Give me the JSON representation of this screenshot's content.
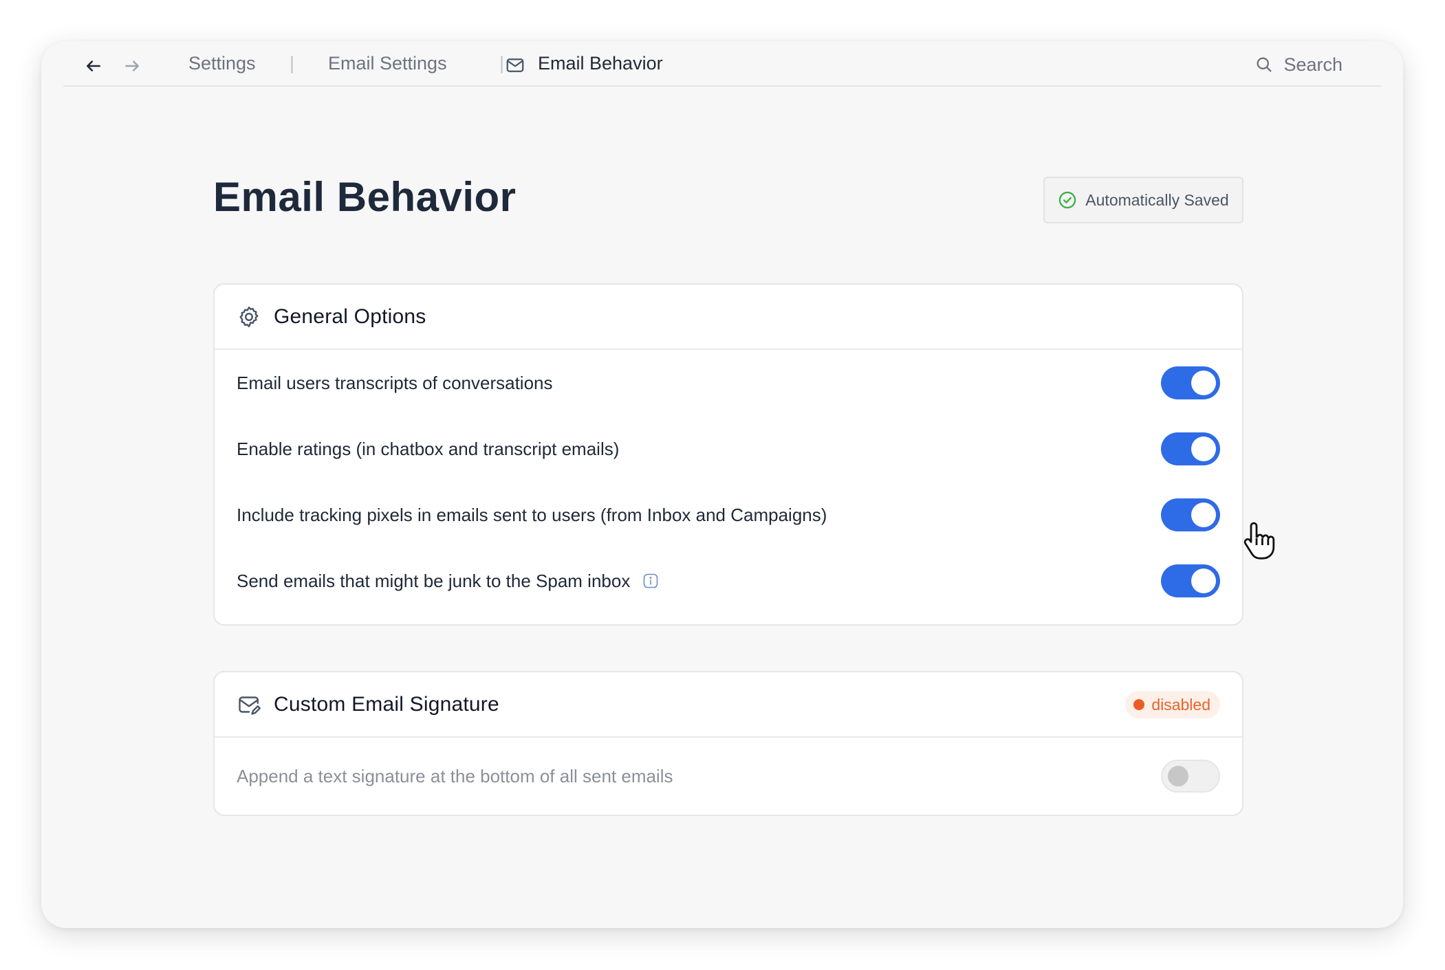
{
  "breadcrumb": {
    "items": [
      "Settings",
      "Email Settings"
    ],
    "separator": "|",
    "current": "Email Behavior"
  },
  "search": {
    "placeholder": "Search"
  },
  "page": {
    "title": "Email Behavior"
  },
  "save_status": {
    "label": "Automatically Saved",
    "color": "#3fae49"
  },
  "general_options": {
    "title": "General Options",
    "icon": "gear-icon",
    "options": [
      {
        "label": "Email users transcripts of conversations",
        "enabled": true
      },
      {
        "label": "Enable ratings (in chatbox and transcript emails)",
        "enabled": true
      },
      {
        "label": "Include tracking pixels in emails sent to users (from Inbox and Campaigns)",
        "enabled": true
      },
      {
        "label": "Send emails that might be junk to the Spam inbox",
        "enabled": true,
        "info_icon": "info-icon"
      }
    ]
  },
  "custom_signature": {
    "title": "Custom Email Signature",
    "icon": "mail-edit-icon",
    "status": "disabled",
    "status_color": "#e8642c",
    "option": {
      "label": "Append a text signature at the bottom of all sent emails",
      "enabled": false
    }
  },
  "colors": {
    "accent": "#2e6be6",
    "background": "#f7f7f7",
    "text": "#1f2937"
  }
}
